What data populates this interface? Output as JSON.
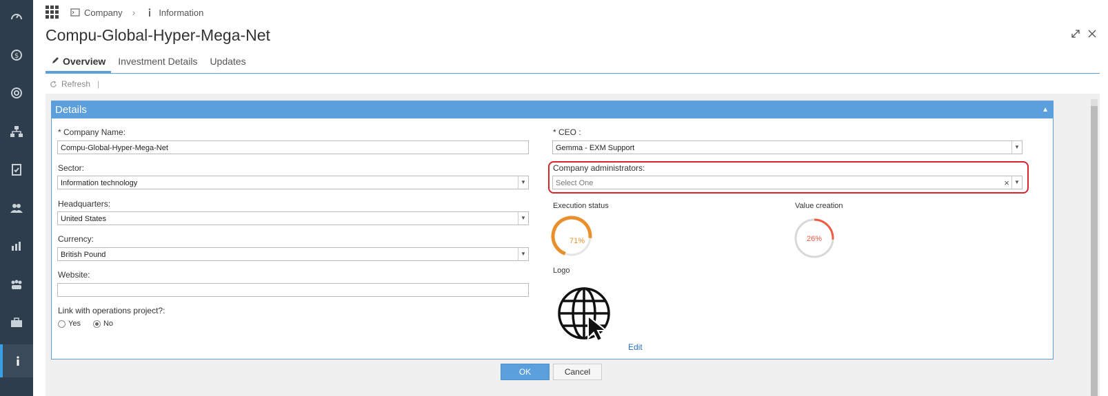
{
  "breadcrumb": {
    "items": [
      "Company",
      "Information"
    ]
  },
  "page": {
    "title": "Compu-Global-Hyper-Mega-Net"
  },
  "tabs": [
    {
      "label": "Overview",
      "active": true
    },
    {
      "label": "Investment Details",
      "active": false
    },
    {
      "label": "Updates",
      "active": false
    }
  ],
  "toolbar": {
    "refresh_label": "Refresh",
    "separator": "|"
  },
  "panel": {
    "title": "Details",
    "collapse_glyph": "▲"
  },
  "form": {
    "company_name": {
      "label": "* Company Name:",
      "value": "Compu-Global-Hyper-Mega-Net"
    },
    "sector": {
      "label": "Sector:",
      "value": "Information technology"
    },
    "headquarters": {
      "label": "Headquarters:",
      "value": "United States"
    },
    "currency": {
      "label": "Currency:",
      "value": "British Pound"
    },
    "website": {
      "label": "Website:",
      "value": ""
    },
    "link_ops": {
      "label": "Link with operations project?:",
      "yes_label": "Yes",
      "no_label": "No",
      "selected": "No"
    },
    "ceo": {
      "label": "* CEO :",
      "value": "Gemma - EXM Support"
    },
    "admins": {
      "label": "Company administrators:",
      "placeholder": "Select One"
    }
  },
  "gauges": {
    "execution": {
      "label": "Execution status",
      "value": 71,
      "text": "71%",
      "color": "#e8912c"
    },
    "value_creation": {
      "label": "Value creation",
      "value": 26,
      "text": "26%",
      "color": "#f05a42"
    }
  },
  "logo": {
    "label": "Logo",
    "icon": "globe-cursor-icon",
    "edit_label": "Edit"
  },
  "actions": {
    "ok_label": "OK",
    "cancel_label": "Cancel"
  },
  "colors": {
    "accent": "#5ba0dc",
    "sidebar": "#2e3d4c",
    "highlight": "#d9232d"
  }
}
